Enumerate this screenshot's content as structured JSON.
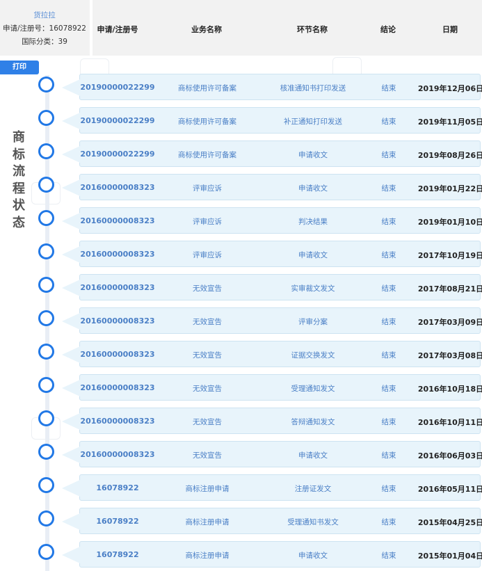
{
  "info": {
    "applicant": "货拉拉",
    "reg_no": "申请/注册号：16078922",
    "intl_class": "国际分类：39"
  },
  "columns": {
    "reg": "申请/注册号",
    "business": "业务名称",
    "step": "环节名称",
    "result": "结论",
    "date": "日期"
  },
  "print_label": "打印",
  "side_title": [
    "商",
    "标",
    "流",
    "程",
    "状",
    "态"
  ],
  "rows": [
    {
      "reg": "20190000022299",
      "business": "商标使用许可备案",
      "step": "核准通知书打印发送",
      "result": "结束",
      "date": "2019年12月06日"
    },
    {
      "reg": "20190000022299",
      "business": "商标使用许可备案",
      "step": "补正通知打印发送",
      "result": "结束",
      "date": "2019年11月05日"
    },
    {
      "reg": "20190000022299",
      "business": "商标使用许可备案",
      "step": "申请收文",
      "result": "结束",
      "date": "2019年08月26日"
    },
    {
      "reg": "20160000008323",
      "business": "评审应诉",
      "step": "申请收文",
      "result": "结束",
      "date": "2019年01月22日"
    },
    {
      "reg": "20160000008323",
      "business": "评审应诉",
      "step": "判决结果",
      "result": "结束",
      "date": "2019年01月10日"
    },
    {
      "reg": "20160000008323",
      "business": "评审应诉",
      "step": "申请收文",
      "result": "结束",
      "date": "2017年10月19日"
    },
    {
      "reg": "20160000008323",
      "business": "无效宣告",
      "step": "实审裁文发文",
      "result": "结束",
      "date": "2017年08月21日"
    },
    {
      "reg": "20160000008323",
      "business": "无效宣告",
      "step": "评审分案",
      "result": "结束",
      "date": "2017年03月09日"
    },
    {
      "reg": "20160000008323",
      "business": "无效宣告",
      "step": "证据交换发文",
      "result": "结束",
      "date": "2017年03月08日"
    },
    {
      "reg": "20160000008323",
      "business": "无效宣告",
      "step": "受理通知发文",
      "result": "结束",
      "date": "2016年10月18日"
    },
    {
      "reg": "20160000008323",
      "business": "无效宣告",
      "step": "答辩通知发文",
      "result": "结束",
      "date": "2016年10月11日"
    },
    {
      "reg": "20160000008323",
      "business": "无效宣告",
      "step": "申请收文",
      "result": "结束",
      "date": "2016年06月03日"
    },
    {
      "reg": "16078922",
      "business": "商标注册申请",
      "step": "注册证发文",
      "result": "结束",
      "date": "2016年05月11日"
    },
    {
      "reg": "16078922",
      "business": "商标注册申请",
      "step": "受理通知书发文",
      "result": "结束",
      "date": "2015年04月25日"
    },
    {
      "reg": "16078922",
      "business": "商标注册申请",
      "step": "申请收文",
      "result": "结束",
      "date": "2015年01月04日"
    }
  ],
  "colors": {
    "accent": "#2178e6",
    "button": "#2f80e7",
    "row_bg": "#e8f4fb",
    "link_text": "#4a7fc6"
  }
}
